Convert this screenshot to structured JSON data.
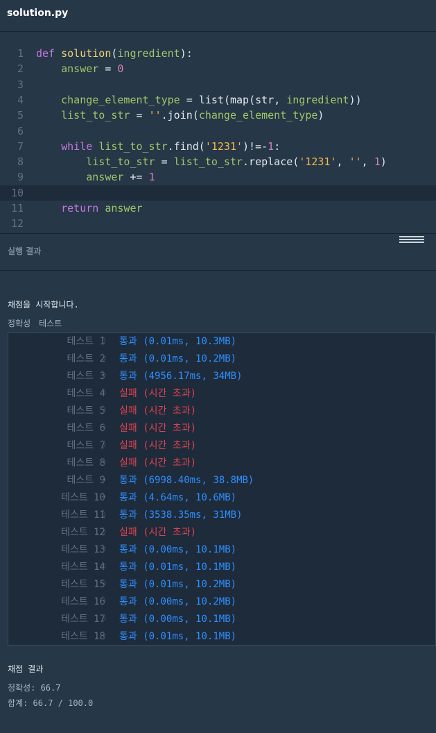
{
  "file": {
    "name": "solution.py"
  },
  "code_lines": [
    {
      "num": "1",
      "tokens": [
        [
          "kw",
          "def "
        ],
        [
          "fn",
          "solution"
        ],
        [
          "op",
          "("
        ],
        [
          "var",
          "ingredient"
        ],
        [
          "op",
          "):"
        ]
      ]
    },
    {
      "num": "2",
      "tokens": [
        [
          "op",
          "    "
        ],
        [
          "var",
          "answer"
        ],
        [
          "op",
          " = "
        ],
        [
          "num",
          "0"
        ]
      ]
    },
    {
      "num": "3",
      "tokens": []
    },
    {
      "num": "4",
      "tokens": [
        [
          "op",
          "    "
        ],
        [
          "var",
          "change_element_type"
        ],
        [
          "op",
          " = "
        ],
        [
          "builtin",
          "list"
        ],
        [
          "op",
          "("
        ],
        [
          "builtin",
          "map"
        ],
        [
          "op",
          "("
        ],
        [
          "builtin",
          "str"
        ],
        [
          "op",
          ", "
        ],
        [
          "var",
          "ingredient"
        ],
        [
          "op",
          "))"
        ]
      ]
    },
    {
      "num": "5",
      "tokens": [
        [
          "op",
          "    "
        ],
        [
          "var",
          "list_to_str"
        ],
        [
          "op",
          " = "
        ],
        [
          "str",
          "''"
        ],
        [
          "op",
          ".join("
        ],
        [
          "var",
          "change_element_type"
        ],
        [
          "op",
          ")"
        ]
      ]
    },
    {
      "num": "6",
      "tokens": []
    },
    {
      "num": "7",
      "tokens": [
        [
          "op",
          "    "
        ],
        [
          "kw",
          "while "
        ],
        [
          "var",
          "list_to_str"
        ],
        [
          "op",
          ".find("
        ],
        [
          "str",
          "'1231'"
        ],
        [
          "op",
          ")!=-"
        ],
        [
          "num",
          "1"
        ],
        [
          "op",
          ":"
        ]
      ]
    },
    {
      "num": "8",
      "tokens": [
        [
          "op",
          "        "
        ],
        [
          "var",
          "list_to_str"
        ],
        [
          "op",
          " = "
        ],
        [
          "var",
          "list_to_str"
        ],
        [
          "op",
          ".replace("
        ],
        [
          "str",
          "'1231'"
        ],
        [
          "op",
          ", "
        ],
        [
          "str",
          "''"
        ],
        [
          "op",
          ", "
        ],
        [
          "num",
          "1"
        ],
        [
          "op",
          ")"
        ]
      ]
    },
    {
      "num": "9",
      "tokens": [
        [
          "op",
          "        "
        ],
        [
          "var",
          "answer"
        ],
        [
          "op",
          " += "
        ],
        [
          "num",
          "1"
        ]
      ]
    },
    {
      "num": "10",
      "tokens": [],
      "active": true
    },
    {
      "num": "11",
      "tokens": [
        [
          "op",
          "    "
        ],
        [
          "kw",
          "return "
        ],
        [
          "var",
          "answer"
        ]
      ]
    },
    {
      "num": "12",
      "tokens": []
    }
  ],
  "result_panel": {
    "title": "실행 결과",
    "start_text": "채점을 시작합니다.",
    "section_labels": [
      "정확성",
      "테스트"
    ]
  },
  "tests": [
    {
      "name": "테스트 1",
      "status": "pass",
      "label": "통과",
      "detail": "(0.01ms, 10.3MB)"
    },
    {
      "name": "테스트 2",
      "status": "pass",
      "label": "통과",
      "detail": "(0.01ms, 10.2MB)"
    },
    {
      "name": "테스트 3",
      "status": "pass",
      "label": "통과",
      "detail": "(4956.17ms, 34MB)"
    },
    {
      "name": "테스트 4",
      "status": "fail",
      "label": "실패",
      "detail": "(시간 초과)"
    },
    {
      "name": "테스트 5",
      "status": "fail",
      "label": "실패",
      "detail": "(시간 초과)"
    },
    {
      "name": "테스트 6",
      "status": "fail",
      "label": "실패",
      "detail": "(시간 초과)"
    },
    {
      "name": "테스트 7",
      "status": "fail",
      "label": "실패",
      "detail": "(시간 초과)"
    },
    {
      "name": "테스트 8",
      "status": "fail",
      "label": "실패",
      "detail": "(시간 초과)"
    },
    {
      "name": "테스트 9",
      "status": "pass",
      "label": "통과",
      "detail": "(6998.40ms, 38.8MB)"
    },
    {
      "name": "테스트 10",
      "status": "pass",
      "label": "통과",
      "detail": "(4.64ms, 10.6MB)"
    },
    {
      "name": "테스트 11",
      "status": "pass",
      "label": "통과",
      "detail": "(3538.35ms, 31MB)"
    },
    {
      "name": "테스트 12",
      "status": "fail",
      "label": "실패",
      "detail": "(시간 초과)"
    },
    {
      "name": "테스트 13",
      "status": "pass",
      "label": "통과",
      "detail": "(0.00ms, 10.1MB)"
    },
    {
      "name": "테스트 14",
      "status": "pass",
      "label": "통과",
      "detail": "(0.01ms, 10.1MB)"
    },
    {
      "name": "테스트 15",
      "status": "pass",
      "label": "통과",
      "detail": "(0.01ms, 10.2MB)"
    },
    {
      "name": "테스트 16",
      "status": "pass",
      "label": "통과",
      "detail": "(0.00ms, 10.2MB)"
    },
    {
      "name": "테스트 17",
      "status": "pass",
      "label": "통과",
      "detail": "(0.00ms, 10.1MB)"
    },
    {
      "name": "테스트 18",
      "status": "pass",
      "label": "통과",
      "detail": "(0.01ms, 10.1MB)"
    }
  ],
  "chevron": "〉",
  "score": {
    "title": "채점 결과",
    "accuracy": "정확성: 66.7",
    "total": "합계: 66.7 / 100.0"
  },
  "colors": {
    "background": "#263747",
    "pass": "#2f8fff",
    "fail": "#e0434f",
    "keyword": "#c678dd",
    "function": "#f1d670",
    "variable": "#9ec76a",
    "number": "#d57fbf",
    "string": "#f1b94d"
  }
}
